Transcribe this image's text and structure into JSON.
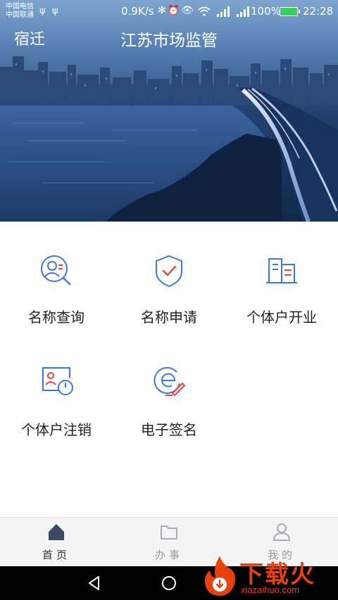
{
  "status_bar": {
    "carrier_1": "中国电信",
    "carrier_2": "中国联通",
    "net_speed": "0.9K/s",
    "icons": "✻⏰👁",
    "battery_pct": "100%",
    "time": "22:28"
  },
  "header": {
    "city": "宿迁",
    "title": "江苏市场监管"
  },
  "services": [
    {
      "label": "名称查询",
      "icon": "person-search-icon"
    },
    {
      "label": "名称申请",
      "icon": "shield-check-icon"
    },
    {
      "label": "个体户开业",
      "icon": "building-icon"
    },
    {
      "label": "个体户注销",
      "icon": "id-card-power-icon"
    },
    {
      "label": "电子签名",
      "icon": "e-signature-icon"
    }
  ],
  "tabs": [
    {
      "label": "首页",
      "icon": "home-icon",
      "active": true
    },
    {
      "label": "办事",
      "icon": "folder-icon",
      "active": false
    },
    {
      "label": "我的",
      "icon": "user-icon",
      "active": false
    }
  ],
  "watermark": {
    "title": "下载火",
    "url": "xiazaihuo.com"
  },
  "colors": {
    "accent": "#3b78e7",
    "accent_red": "#e8473c",
    "tab_active": "#3a4a66",
    "tab_inactive": "#a6adb8",
    "watermark": "#e8410c"
  }
}
